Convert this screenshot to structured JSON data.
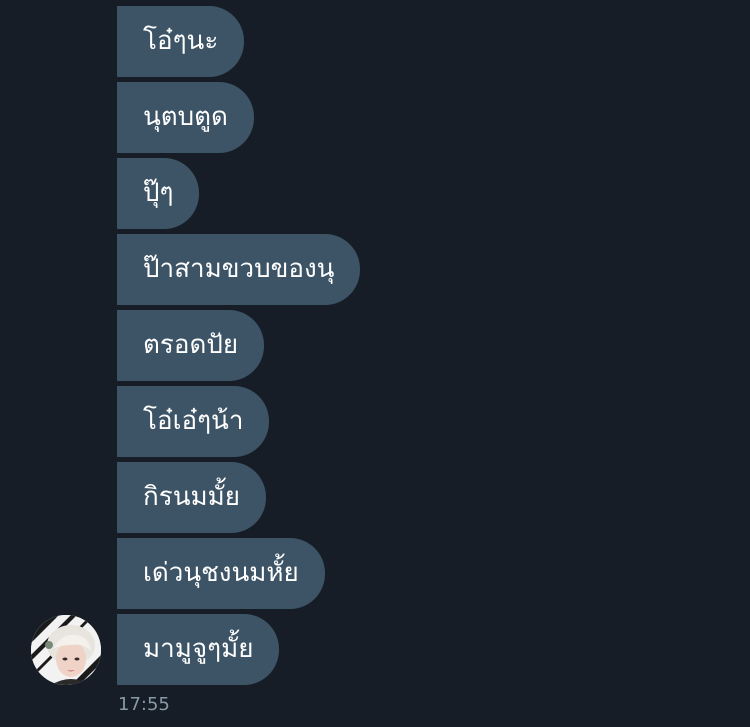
{
  "messages": [
    "โอ๋ๆนะ",
    "นุตบตูด",
    "ปุ๊ๆ",
    "ป๊าสามขวบของนุ",
    "ตรอดปัย",
    "โอ๋เอ๋ๆน้า",
    "กิรนมมั้ย",
    "เด่วนุชงนมหั้ย",
    "มามูจูๆมั้ย"
  ],
  "timestamp": "17:55",
  "colors": {
    "background": "#161d26",
    "bubble": "#3d5466",
    "timestamp": "#8899a6"
  }
}
